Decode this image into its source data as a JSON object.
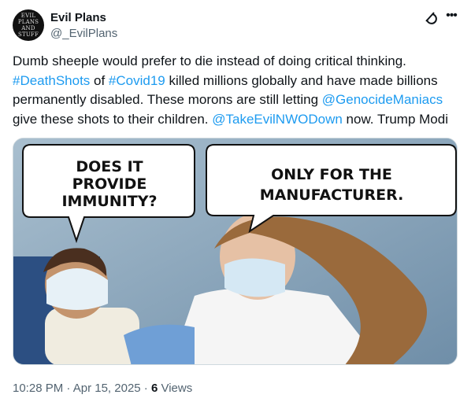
{
  "post": {
    "avatar_text": "EVIL PLANS AND STUFF",
    "author_name": "Evil Plans",
    "author_handle": "@_EvilPlans",
    "text_1": "Dumb sheeple would prefer to die instead of doing critical thinking. ",
    "hashtag_1": "#DeathShots",
    "text_2": " of ",
    "hashtag_2": "#Covid19",
    "text_3": " killed millions globally and have made billions permanently disabled. These morons are still letting ",
    "mention_1": "@GenocideManiacs",
    "text_4": " give these shots to their children. ",
    "mention_2": "@TakeEvilNWODown",
    "text_5": " now. Trump Modi"
  },
  "image": {
    "bubble_left_line1": "DOES IT",
    "bubble_left_line2": "PROVIDE",
    "bubble_left_line3": "IMMUNITY?",
    "bubble_right_line1": "ONLY FOR THE",
    "bubble_right_line2": "MANUFACTURER."
  },
  "meta": {
    "time": "10:28 PM",
    "sep1": " · ",
    "date": "Apr 15, 2025",
    "sep2": " · ",
    "views_count": "6",
    "views_label": " Views"
  },
  "icons": {
    "grok": "grok-icon",
    "more": "more-options-icon"
  },
  "colors": {
    "link": "#1d9bf0",
    "secondary": "#536471",
    "text": "#0f1419"
  }
}
